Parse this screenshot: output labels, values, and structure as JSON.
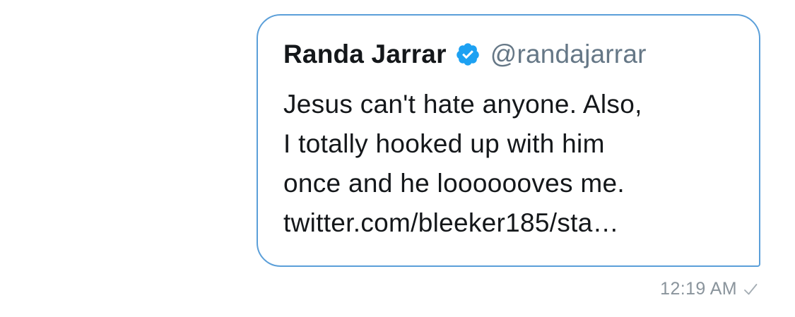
{
  "message": {
    "quoted_tweet": {
      "author_name": "Randa Jarrar",
      "author_handle": "@randajarrar",
      "verified_icon": "verified-badge-icon",
      "text_lines": [
        "Jesus can't hate anyone. Also,",
        "I totally hooked up with him",
        "once and he looooooves me."
      ],
      "link_text": "twitter.com/bleeker185/sta…"
    },
    "timestamp": "12:19 AM",
    "status_icon": "sent-check-icon"
  },
  "colors": {
    "bubble_border": "#5b9fd9",
    "verified_blue": "#1da1f2",
    "primary_text": "#14171a",
    "secondary_text": "#657786",
    "timestamp_text": "#8a949c"
  }
}
